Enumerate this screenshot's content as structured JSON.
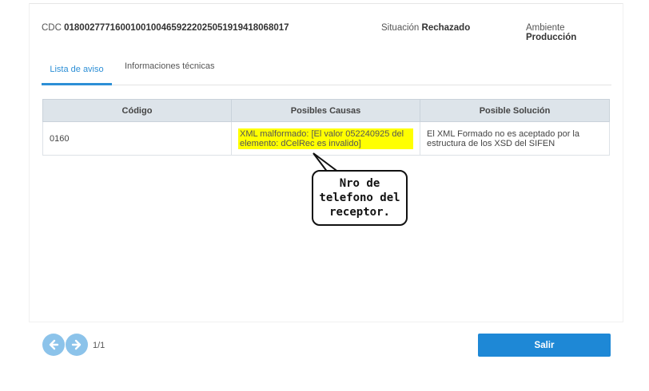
{
  "header": {
    "cdc_label": "CDC",
    "cdc_value": "01800277716001001004659222025051919418068017",
    "situacion_label": "Situación",
    "situacion_value": "Rechazado",
    "ambiente_label": "Ambiente",
    "ambiente_value": "Producción"
  },
  "tabs": [
    {
      "label": "Lista de aviso",
      "active": true
    },
    {
      "label": "Informaciones técnicas",
      "active": false
    }
  ],
  "table": {
    "headers": [
      "Código",
      "Posibles Causas",
      "Posible Solución"
    ],
    "rows": [
      {
        "codigo": "0160",
        "causa": "XML malformado: [El valor 052240925 del elemento: dCelRec es invalido]",
        "solucion": "El XML Formado no es aceptado por la estructura de los XSD del SIFEN"
      }
    ]
  },
  "callout": {
    "line1": "Nro de",
    "line2": "telefono del",
    "line3": "receptor."
  },
  "pagination": {
    "indicator": "1/1"
  },
  "buttons": {
    "salir": "Salir"
  },
  "colors": {
    "accent": "#1e88d6",
    "highlight": "#ffff00",
    "nav": "#8cc3ea"
  }
}
